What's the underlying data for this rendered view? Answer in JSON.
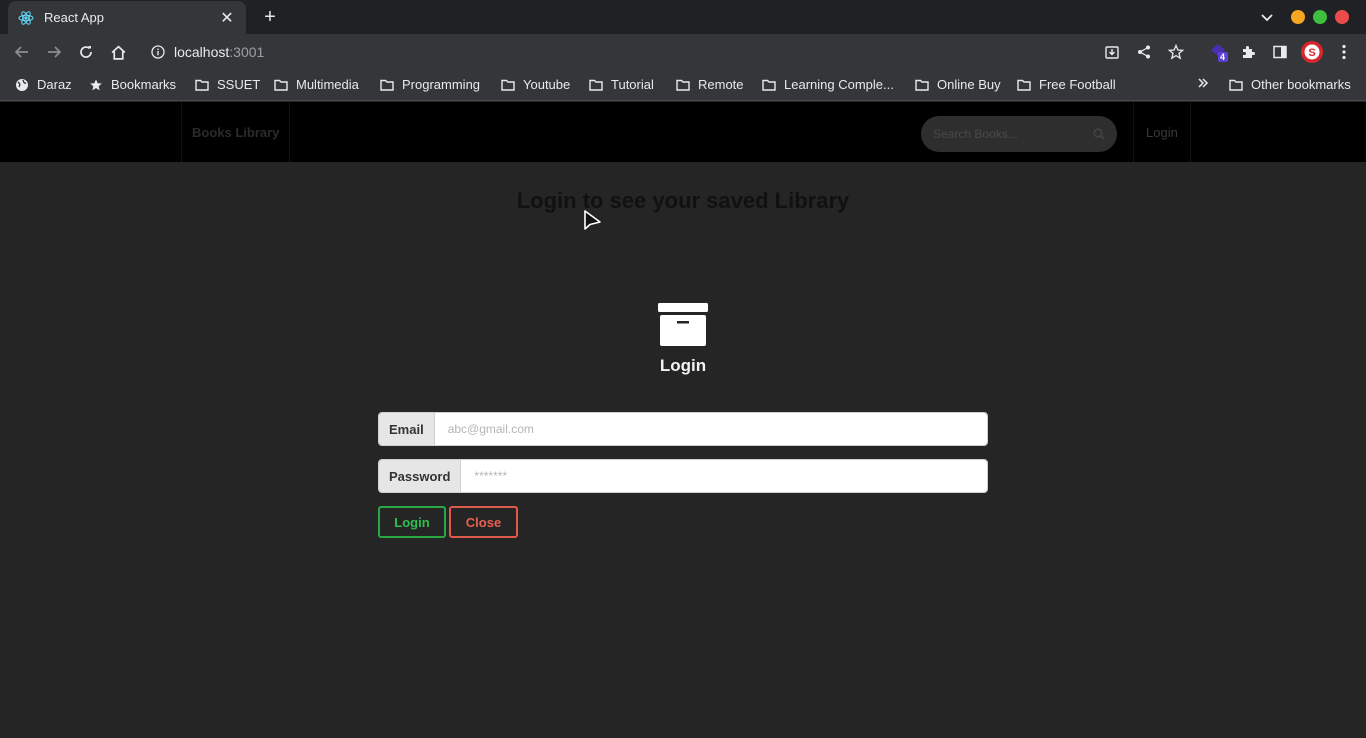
{
  "browser": {
    "tab_title": "React App",
    "url_host": "localhost",
    "url_port": ":3001",
    "extension_badge": "4",
    "bookmarks": [
      "Daraz",
      "Bookmarks",
      "SSUET",
      "Multimedia",
      "Programming",
      "Youtube",
      "Tutorial",
      "Remote",
      "Learning Comple...",
      "Online Buy",
      "Free Football"
    ],
    "other_bookmarks": "Other bookmarks"
  },
  "navbar": {
    "brand": "Books Library",
    "search_placeholder": "Search Books...",
    "login_link": "Login"
  },
  "page": {
    "heading": "Login to see your saved Library",
    "form_title": "Login",
    "email_label": "Email",
    "email_placeholder": "abc@gmail.com",
    "password_label": "Password",
    "password_placeholder": "*******",
    "login_button": "Login",
    "close_button": "Close"
  },
  "colors": {
    "page_bg": "#252525",
    "navbar_bg": "#000000",
    "login_green": "#28a745",
    "close_red": "#e05a4c"
  }
}
